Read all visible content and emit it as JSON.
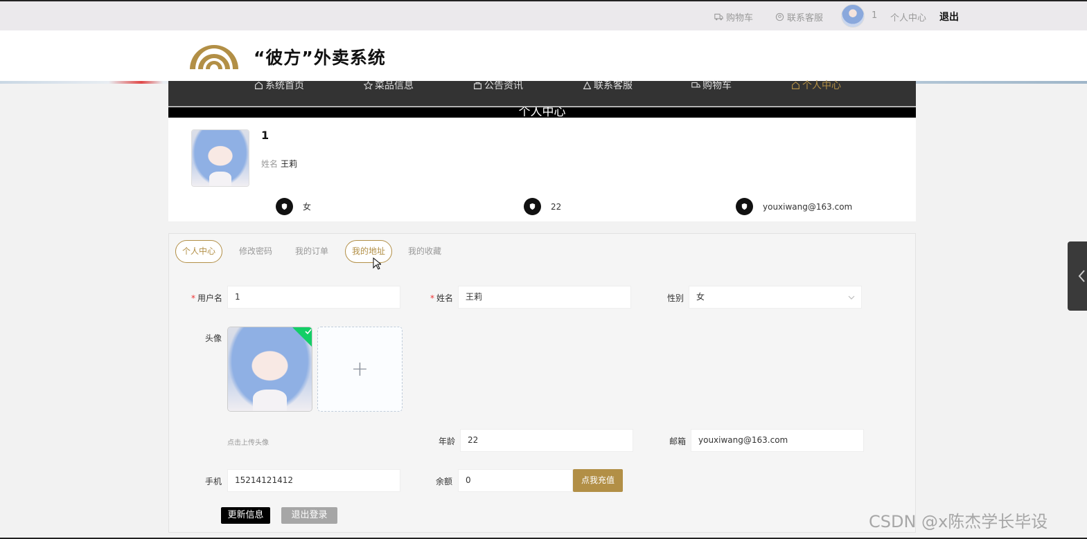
{
  "topbar": {
    "cart": "购物车",
    "service": "联系客服",
    "username": "1",
    "center": "个人中心",
    "logout": "退出"
  },
  "header": {
    "title": "“彼方”外卖系统"
  },
  "nav": {
    "items": [
      "系统首页",
      "菜品信息",
      "公告资讯",
      "联系客服",
      "购物车",
      "个人中心"
    ]
  },
  "section_title": "个人中心",
  "profile": {
    "username": "1",
    "name_label": "姓名",
    "name": "王莉",
    "gender": "女",
    "age": "22",
    "email": "youxiwang@163.com"
  },
  "tabs": [
    "个人中心",
    "修改密码",
    "我的订单",
    "我的地址",
    "我的收藏"
  ],
  "form": {
    "username_label": "用户名",
    "username_value": "1",
    "name_label": "姓名",
    "name_value": "王莉",
    "gender_label": "性别",
    "gender_value": "女",
    "avatar_label": "头像",
    "upload_tip": "点击上传头像",
    "age_label": "年龄",
    "age_value": "22",
    "email_label": "邮箱",
    "email_value": "youxiwang@163.com",
    "phone_label": "手机",
    "phone_value": "15214121412",
    "balance_label": "余额",
    "balance_value": "0",
    "recharge_button": "点我充值",
    "update_button": "更新信息",
    "logout_button": "退出登录"
  },
  "watermark": "CSDN @x陈杰学长毕设",
  "colors": {
    "accent": "#b28f46",
    "nav_bg": "#333333",
    "success": "#13ce66",
    "required": "#ee3333"
  }
}
